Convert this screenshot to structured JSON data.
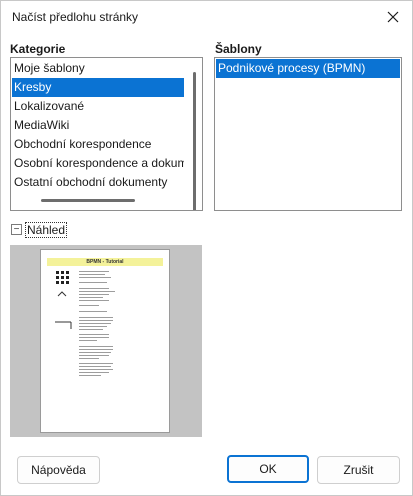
{
  "window": {
    "title": "Načíst předlohu stránky"
  },
  "categories": {
    "label": "Kategorie",
    "items": [
      {
        "label": "Moje šablony",
        "selected": false
      },
      {
        "label": "Kresby",
        "selected": true
      },
      {
        "label": "Lokalizované",
        "selected": false
      },
      {
        "label": "MediaWiki",
        "selected": false
      },
      {
        "label": "Obchodní korespondence",
        "selected": false
      },
      {
        "label": "Osobní korespondence a dokumenty",
        "selected": false
      },
      {
        "label": "Ostatní obchodní dokumenty",
        "selected": false
      }
    ]
  },
  "templates": {
    "label": "Šablony",
    "items": [
      {
        "label": "Podnikové procesy (BPMN)",
        "selected": true
      }
    ]
  },
  "preview": {
    "label": "Náhled",
    "toggle_symbol": "−",
    "expanded": true,
    "page_title": "BPMN - Tutorial"
  },
  "buttons": {
    "help": "Nápověda",
    "ok": "OK",
    "cancel": "Zrušit"
  },
  "colors": {
    "selection": "#0b73d3",
    "preview_bg": "#c3c3c3",
    "page_title_highlight": "#f4f29a"
  },
  "icons": {
    "close": "close-icon",
    "collapse": "minus-box-icon"
  }
}
